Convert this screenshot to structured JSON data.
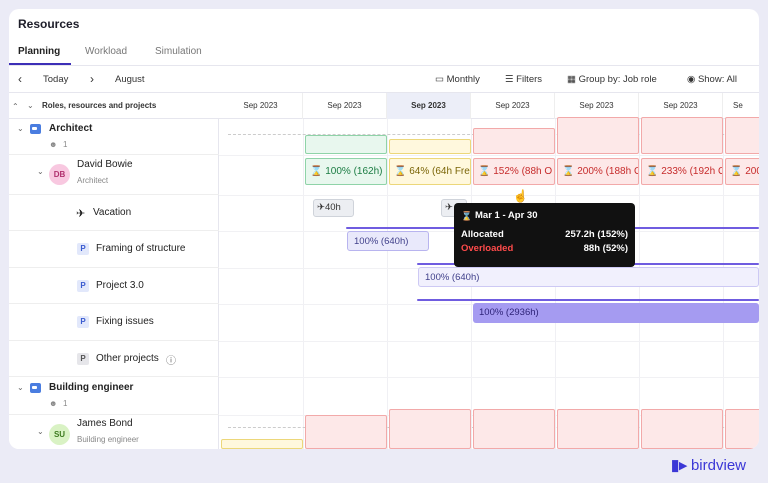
{
  "app_title": "Resources",
  "tabs": [
    {
      "label": "Planning"
    },
    {
      "label": "Workload"
    },
    {
      "label": "Simulation"
    }
  ],
  "toolbar": {
    "prev": "‹",
    "today": "Today",
    "next": "›",
    "period": "August",
    "monthly": "Monthly",
    "filters": "Filters",
    "group_by": "Group by: Job role",
    "show": "Show: All"
  },
  "left_header": "Roles, resources and projects",
  "months": [
    "Sep 2023",
    "Sep 2023",
    "Sep 2023",
    "Sep 2023",
    "Sep 2023",
    "Sep 2023",
    "Se"
  ],
  "rows": {
    "architect": {
      "label": "Architect",
      "count": "1"
    },
    "david": {
      "name": "David Bowie",
      "role": "Architect",
      "initials": "DB"
    },
    "vacation": {
      "label": "Vacation"
    },
    "framing": {
      "badge": "P",
      "label": "Framing of structure"
    },
    "project3": {
      "badge": "P",
      "label": "Project 3.0"
    },
    "fixing": {
      "badge": "P",
      "label": "Fixing issues"
    },
    "other": {
      "badge": "P",
      "label": "Other projects"
    },
    "building": {
      "label": "Building engineer",
      "count": "1"
    },
    "james": {
      "name": "James Bond",
      "role": "Building engineer",
      "initials": "SU"
    }
  },
  "cells": [
    {
      "text": "100% (162h)"
    },
    {
      "text": "64% (64h Fre"
    },
    {
      "text": "152% (88h O"
    },
    {
      "text": "200% (188h O"
    },
    {
      "text": "233% (192h O"
    },
    {
      "text": "200"
    }
  ],
  "vacation_badges": [
    {
      "text": "40h"
    },
    {
      "text": ""
    }
  ],
  "bars": [
    {
      "text": "100% (640h)"
    },
    {
      "text": "100% (640h)"
    },
    {
      "text": "100% (2936h)"
    }
  ],
  "tooltip": {
    "range": "Mar 1 - Apr 30",
    "allocated_label": "Allocated",
    "allocated_value": "257.2h (152%)",
    "overloaded_label": "Overloaded",
    "overloaded_value": "88h (52%)"
  },
  "brand": "birdview",
  "colors": {
    "accent": "#3d2fb7",
    "overload": "#e23b3b"
  }
}
